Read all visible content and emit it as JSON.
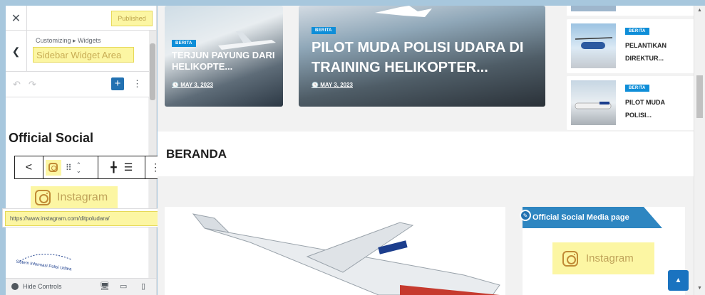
{
  "panel": {
    "close_icon": "close-icon",
    "published_label": "Published",
    "breadcrumb": "Customizing ▸ Widgets",
    "section_title": "Sidebar Widget Area",
    "undo_icon": "undo-icon",
    "redo_icon": "redo-icon",
    "add_block_icon": "plus-icon",
    "options_icon": "kebab-icon"
  },
  "editor": {
    "widget_heading": "Official Social",
    "block_toolbar": {
      "share_icon": "share-icon",
      "instagram_icon": "instagram-icon",
      "drag_icon": "drag-handle-icon",
      "move_icon": "chevron-updown-icon",
      "justify_left_icon": "justify-icon",
      "justify_center_icon": "align-center-icon",
      "more_icon": "kebab-icon"
    },
    "social_link_label": "Instagram",
    "url_value": "https://www.instagram.com/ditpoludara/",
    "submit_icon": "return-icon",
    "logo_text": "Sistem Informasi Polisi Udara"
  },
  "footer": {
    "hide_controls_label": "Hide Controls",
    "devices": [
      "desktop-icon",
      "tablet-icon",
      "mobile-icon"
    ]
  },
  "preview": {
    "featured": [
      {
        "badge": "BERITA",
        "title": "TERJUN PAYUNG DARI HELIKOPTE...",
        "date": "MAY 3, 2023"
      },
      {
        "badge": "BERITA",
        "title": "PILOT MUDA POLISI UDARA DI TRAINING HELIKOPTER...",
        "date": "MAY 3, 2023"
      }
    ],
    "side_posts": [
      {
        "badge": "BERITA",
        "title": "PELANTIKAN DIREKTUR..."
      },
      {
        "badge": "BERITA",
        "title": "PILOT MUDA POLISI..."
      }
    ],
    "section_heading": "BERANDA",
    "widget_title": "Official Social Media page",
    "widget_link": "Instagram",
    "scroll_top_icon": "chevron-up-icon"
  },
  "colors": {
    "accent": "#2271b1",
    "badge": "#0f8ed8",
    "highlight": "#fcf6a3",
    "widget_title_bg": "#2e86c1"
  }
}
